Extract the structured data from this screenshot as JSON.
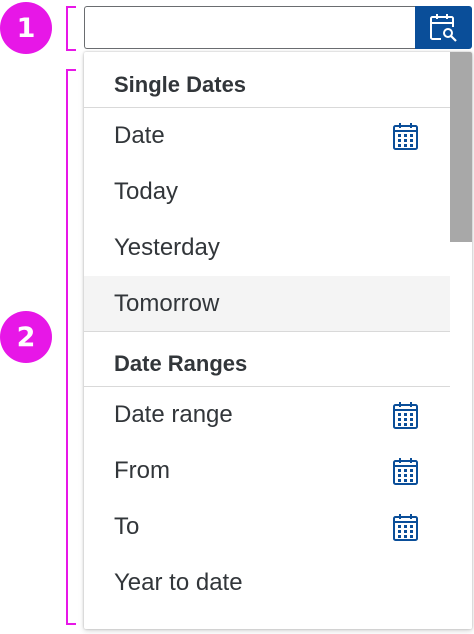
{
  "markers": {
    "one": "1",
    "two": "2"
  },
  "input": {
    "value": "",
    "placeholder": ""
  },
  "popover": {
    "groups": [
      {
        "header": "Single Dates",
        "items": [
          {
            "label": "Date",
            "icon": "calendar-icon"
          },
          {
            "label": "Today"
          },
          {
            "label": "Yesterday"
          },
          {
            "label": "Tomorrow",
            "hovered": true
          }
        ]
      },
      {
        "header": "Date Ranges",
        "items": [
          {
            "label": "Date range",
            "icon": "calendar-icon"
          },
          {
            "label": "From",
            "icon": "calendar-icon"
          },
          {
            "label": "To",
            "icon": "calendar-icon"
          },
          {
            "label": "Year to date"
          }
        ]
      }
    ]
  },
  "colors": {
    "marker": "#e717e7",
    "accent": "#0a4e99",
    "text": "#32363a",
    "hover": "#f4f4f4",
    "scrollbar": "#a8a8a8"
  }
}
